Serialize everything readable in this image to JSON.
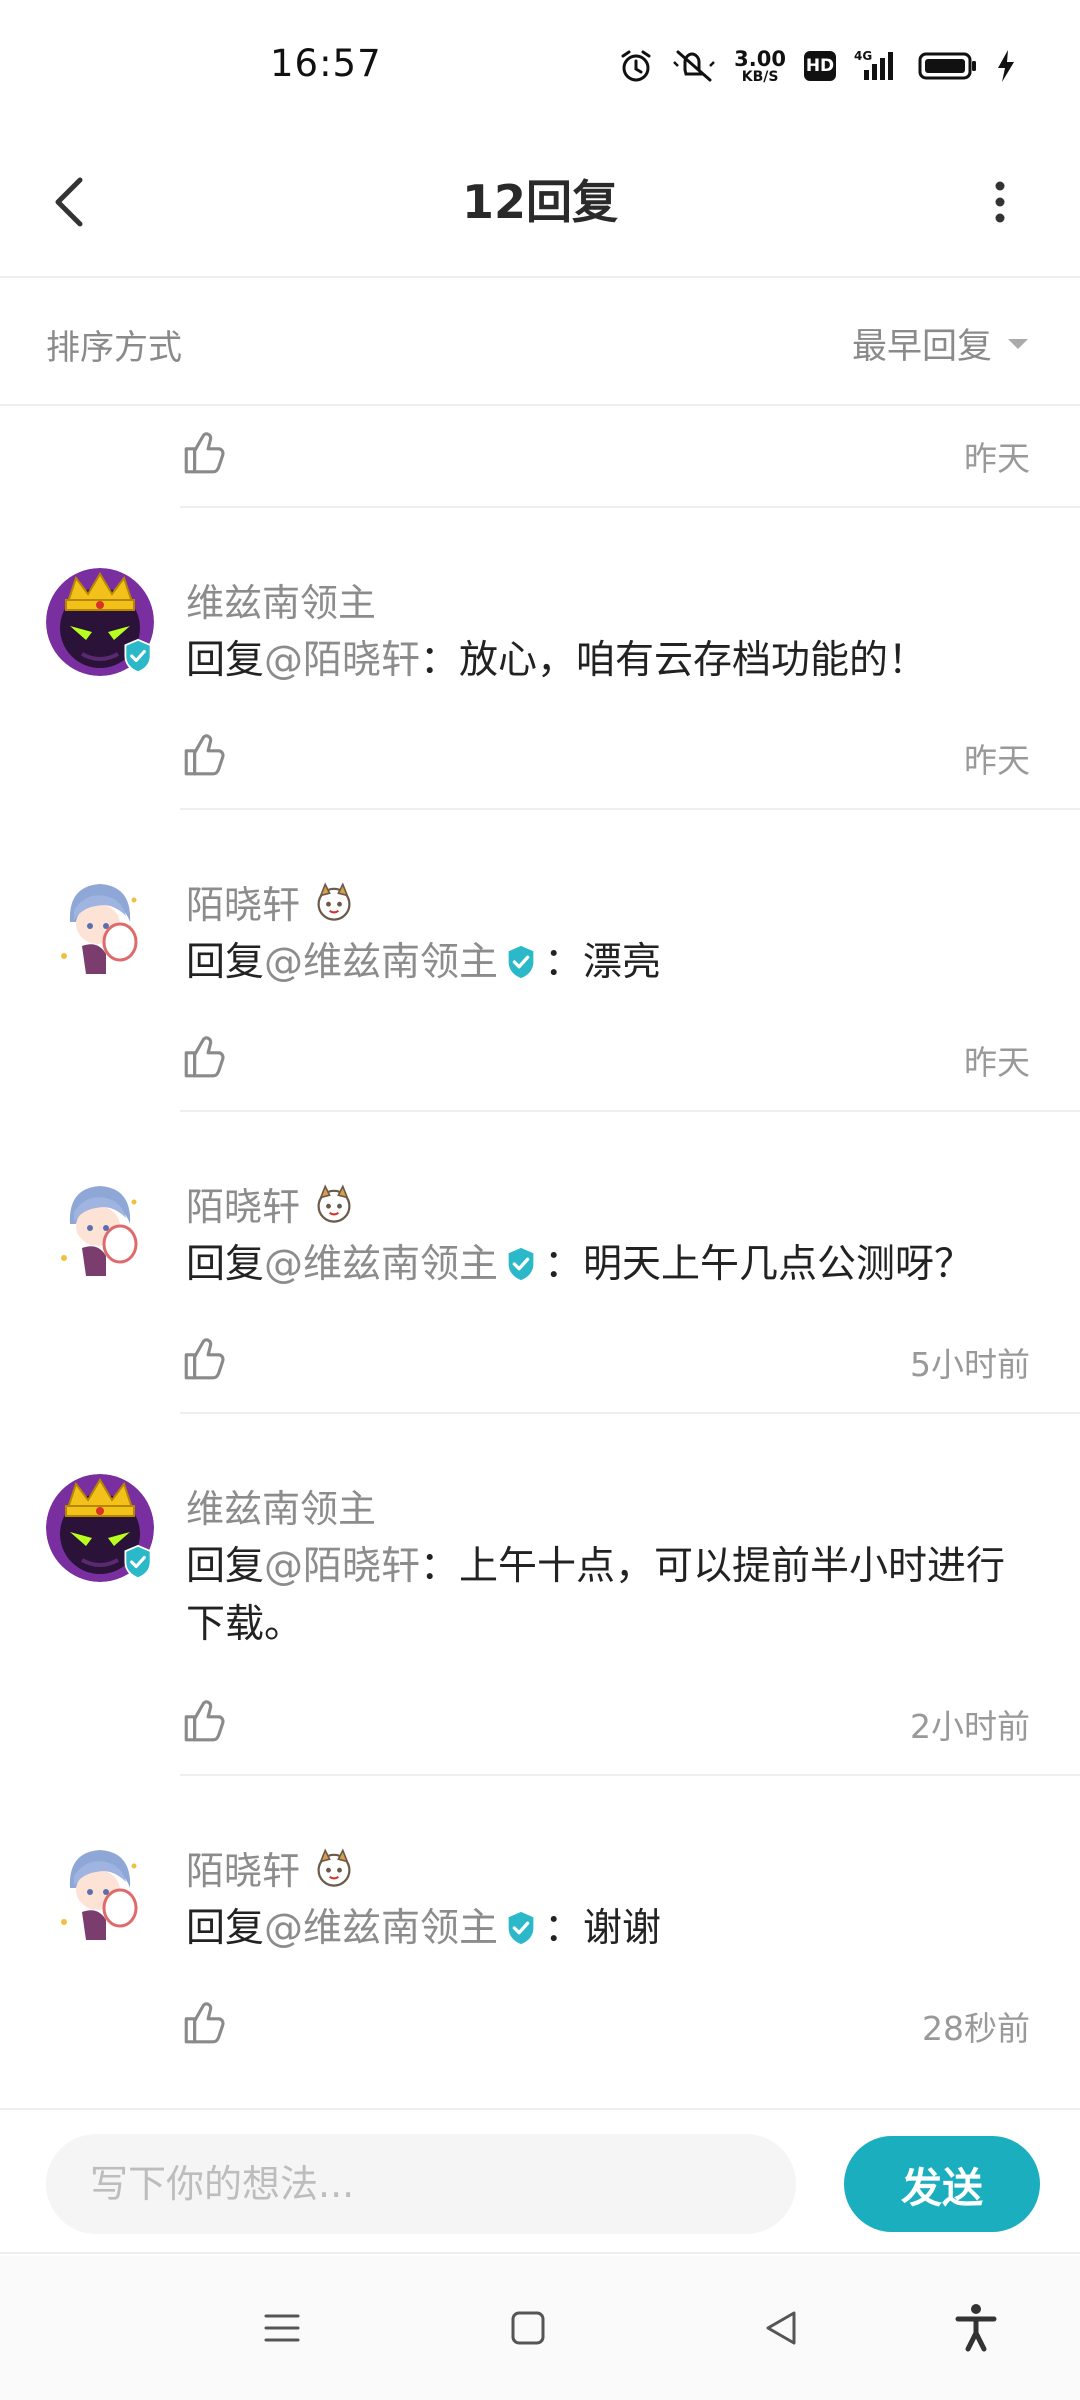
{
  "status_bar": {
    "time": "16:57",
    "net_speed_value": "3.00",
    "net_speed_unit": "KB/S",
    "hd_badge": "HD",
    "signal_label": "4G",
    "icons": [
      "alarm-icon",
      "mute-icon",
      "hd-icon",
      "signal-icon",
      "battery-icon",
      "charging-icon"
    ]
  },
  "header": {
    "title": "12回复",
    "back_icon": "chevron-left-icon",
    "more_icon": "more-vertical-icon"
  },
  "sort": {
    "label": "排序方式",
    "value": "最早回复"
  },
  "colors": {
    "accent": "#1aaebf",
    "verified": "#2bb8c8",
    "divider": "#eeeeee",
    "muted_text": "#8c8c8c"
  },
  "replies": [
    {
      "author": "",
      "prefix": "",
      "mention": "",
      "mention_verified": false,
      "text": "",
      "time": "昨天"
    },
    {
      "author": "维兹南领主",
      "author_verified": true,
      "prefix": "回复",
      "mention": "@陌晓轩",
      "mention_verified": false,
      "text": "：放心，咱有云存档功能的！",
      "time": "昨天"
    },
    {
      "author": "陌晓轩",
      "author_verified": false,
      "prefix": "回复",
      "mention": "@维兹南领主",
      "mention_verified": true,
      "text": "：漂亮",
      "time": "昨天"
    },
    {
      "author": "陌晓轩",
      "author_verified": false,
      "prefix": "回复",
      "mention": "@维兹南领主",
      "mention_verified": true,
      "text": "：明天上午几点公测呀？",
      "time": "5小时前"
    },
    {
      "author": "维兹南领主",
      "author_verified": true,
      "prefix": "回复",
      "mention": "@陌晓轩",
      "mention_verified": false,
      "text": "：上午十点，可以提前半小时进行下载。",
      "time": "2小时前"
    },
    {
      "author": "陌晓轩",
      "author_verified": false,
      "prefix": "回复",
      "mention": "@维兹南领主",
      "mention_verified": true,
      "text": "：谢谢",
      "time": "28秒前"
    }
  ],
  "composer": {
    "placeholder": "写下你的想法...",
    "value": "",
    "send_label": "发送"
  },
  "nav": {
    "icons": [
      "menu-icon",
      "home-square-icon",
      "back-triangle-icon",
      "accessibility-icon"
    ]
  }
}
